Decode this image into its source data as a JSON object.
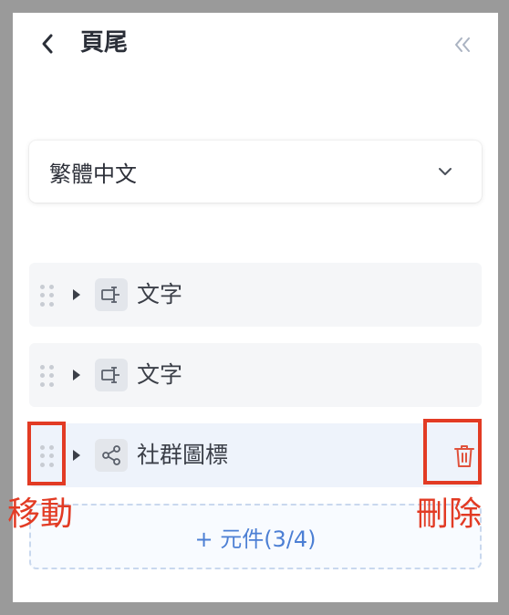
{
  "header": {
    "title": "頁尾"
  },
  "language_select": {
    "value": "繁體中文"
  },
  "components": [
    {
      "label": "文字",
      "type_icon": "text-component-icon"
    },
    {
      "label": "文字",
      "type_icon": "text-component-icon"
    },
    {
      "label": "社群圖標",
      "type_icon": "share-icon",
      "active": true
    }
  ],
  "add_button": {
    "label": "+ 元件(3/4)"
  },
  "annotations": {
    "move": "移動",
    "delete": "刪除"
  },
  "colors": {
    "accent": "#4c7fd4",
    "annotation": "#e23b24",
    "delete_icon": "#e0523c"
  }
}
